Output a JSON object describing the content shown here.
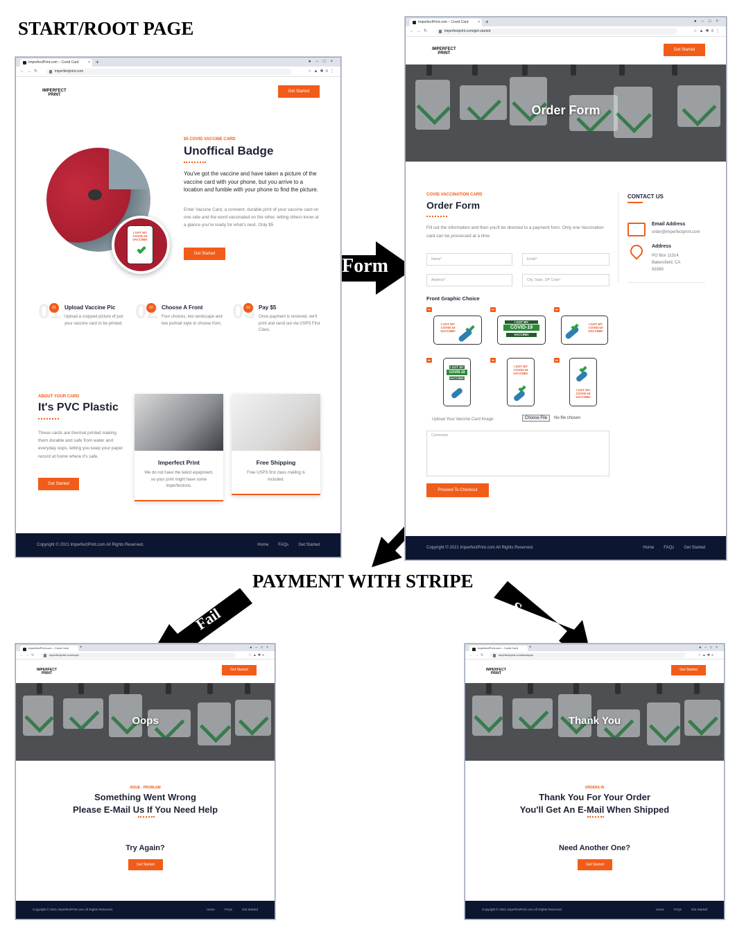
{
  "annotations": {
    "start_root": "START/ROOT PAGE",
    "order_form_arrow": "Order Form",
    "payment": "PAYMENT WITH STRIPE",
    "fail_arrow": "Fail",
    "success_arrow": "Success"
  },
  "browser": {
    "tab_title": "ImperfectPrint.com – Covid Card",
    "urls": {
      "root": "imperfectprint.com",
      "order": "imperfectprint.com/get-started",
      "oops": "imperfectprint.com/oops",
      "thanks": "imperfectprint.com/thankyou"
    }
  },
  "site": {
    "logo_line1": "IMPERFECT",
    "logo_line2": "PRINT",
    "cta": "Get Started"
  },
  "root": {
    "eyebrow": "$5 COVID VACCINE CARD",
    "title": "Unoffical Badge",
    "lead": "You've got the vaccine and have taken a picture of the vaccine card with your phone, but you arrive to a location and fumble with your phone to find the picture.",
    "body": "Enter Vaccine Card, a convient, durable print of your vaccine card on one side and the word vaccinated on the other, letting others know at a glance you're ready for what's next. Only $5",
    "cta": "Get Started",
    "badge_text": "I GOT MY COVID-19 VACCINE!",
    "steps": [
      {
        "num": "01",
        "bg": "01",
        "title": "Upload Vaccine Pic",
        "text": "Upload a cropped picture of just your vaccine card to be printed."
      },
      {
        "num": "02",
        "bg": "02",
        "title": "Choose A Front",
        "text": "Four choices, two landscape and two portrait style to choose from."
      },
      {
        "num": "03",
        "bg": "03",
        "title": "Pay $5",
        "text": "Once payment is recieved, we'll print and send out via USPS First Class."
      }
    ],
    "about_eyebrow": "ABOUT YOUR CARD",
    "about_title": "It's PVC Plastic",
    "about_text": "These cards are thermal printed making them durable and safe from water and everyday oops, letting you keep your paper record at home where it's safe.",
    "about_cta": "Get Started",
    "feature1_title": "Imperfect Print",
    "feature1_text": "We do not have the latest equipment, so your print might have some imperfections.",
    "feature2_title": "Free Shipping",
    "feature2_text": "Free USPS first class mailing is included."
  },
  "order": {
    "hero_title": "Order Form",
    "eyebrow": "COVID VACCINATION CARD",
    "title": "Order Form",
    "intro": "Fill out the information and then you'll be directed to a payment form. Only one Vaccination card can be processed at a time.",
    "placeholders": {
      "name": "Name*",
      "email": "Email*",
      "address": "Address*",
      "city": "City, State, ZIP Code*",
      "comments": "Comments"
    },
    "choice_label": "Front Graphic Choice",
    "upload_label": "Upload Your Vaccine Card Image:",
    "choose_file": "Choose File",
    "no_file": "No file chosen",
    "submit": "Proceed To Checkout",
    "contact_title": "CONTACT US",
    "email_label": "Email Address",
    "email_value": "order@imperfectprint.com",
    "address_label": "Address",
    "address_lines": [
      "PO Box 11314",
      "Bakersfield, CA",
      "93389"
    ],
    "card_text_a": "I GOT MY COVID-19 VACCINE!",
    "card_text_b": "I GOT MY",
    "card_text_c": "COVID-19",
    "card_text_d": "VACCINE!"
  },
  "oops": {
    "hero_title": "Oops",
    "eyebrow": "ISSUE - PROBLEM",
    "line1": "Something Went Wrong",
    "line2": "Please E-Mail Us If You Need Help",
    "sub": "Try Again?",
    "cta": "Get Started"
  },
  "thanks": {
    "hero_title": "Thank You",
    "eyebrow": "ORDERS IN",
    "line1": "Thank You For Your Order",
    "line2": "You'll Get An E-Mail When Shipped",
    "sub": "Need Another One?",
    "cta": "Get Started"
  },
  "footer": {
    "copyright": "Copyright © 2021 ImperfectPrint.com All Rights Reserved.",
    "links": [
      "Home",
      "FAQs",
      "Get Started"
    ]
  },
  "colors": {
    "accent": "#f25c19",
    "footer": "#0d1630",
    "text": "#1d2235"
  }
}
